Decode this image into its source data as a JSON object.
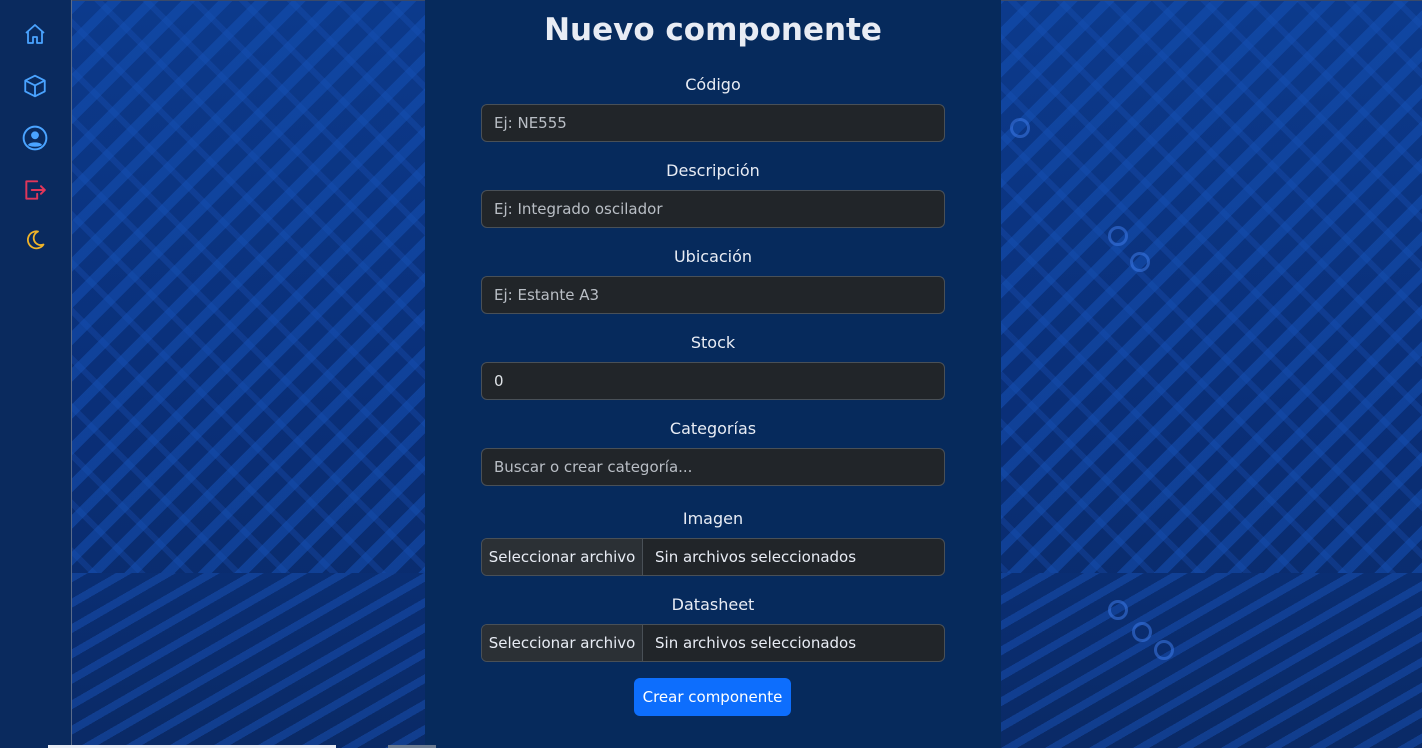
{
  "app": {
    "title": "Nuevo componente"
  },
  "sidebar": {
    "items": [
      {
        "name": "home",
        "icon": "home-icon",
        "color": "#4aa3ff"
      },
      {
        "name": "components",
        "icon": "box-icon",
        "color": "#4aa3ff"
      },
      {
        "name": "profile",
        "icon": "user-circle-icon",
        "color": "#4aa3ff"
      },
      {
        "name": "logout",
        "icon": "logout-icon",
        "color": "#e0365a"
      },
      {
        "name": "theme",
        "icon": "moon-icon",
        "color": "#f0b429"
      }
    ]
  },
  "form": {
    "code": {
      "label": "Código",
      "placeholder": "Ej: NE555",
      "value": ""
    },
    "description": {
      "label": "Descripción",
      "placeholder": "Ej: Integrado oscilador",
      "value": ""
    },
    "location": {
      "label": "Ubicación",
      "placeholder": "Ej: Estante A3",
      "value": ""
    },
    "stock": {
      "label": "Stock",
      "placeholder": "",
      "value": "0"
    },
    "categories": {
      "label": "Categorías",
      "placeholder": "Buscar o crear categoría...",
      "value": ""
    },
    "image": {
      "label": "Imagen",
      "button_label": "Seleccionar archivo",
      "status": "Sin archivos seleccionados"
    },
    "datasheet": {
      "label": "Datasheet",
      "button_label": "Seleccionar archivo",
      "status": "Sin archivos seleccionados"
    },
    "submit_label": "Crear componente"
  },
  "colors": {
    "accent": "#0d6efd",
    "panel": "#062a5c",
    "input_bg": "#212529"
  }
}
